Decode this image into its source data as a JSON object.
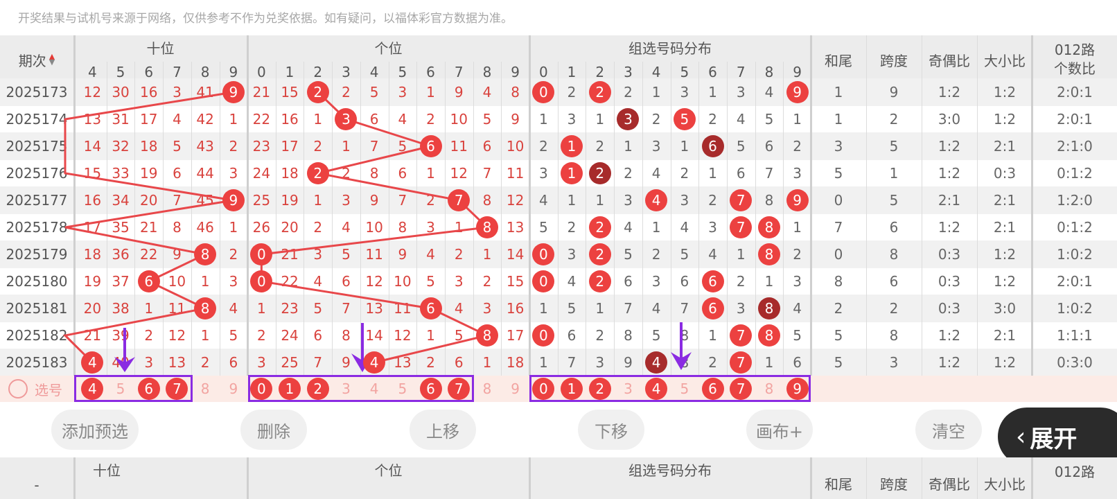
{
  "notice": "开奖结果与试机号来源于网络，仅供参考不作为兑奖依据。如有疑问，以福体彩官方数据为准。",
  "table_header": {
    "period_label": "期次",
    "tens_label": "十位",
    "units_label": "个位",
    "group_label": "组选号码分布",
    "sum_tail_label": "和尾",
    "span_label": "跨度",
    "odd_even_label": "奇偶比",
    "big_small_label": "大小比",
    "route_label_1": "012路",
    "route_label_2": "个数比",
    "tens_digits": [
      "4",
      "5",
      "6",
      "7",
      "8",
      "9"
    ],
    "units_digits": [
      "0",
      "1",
      "2",
      "3",
      "4",
      "5",
      "6",
      "7",
      "8",
      "9"
    ],
    "group_digits": [
      "0",
      "1",
      "2",
      "3",
      "4",
      "5",
      "6",
      "7",
      "8",
      "9"
    ]
  },
  "rows": [
    {
      "period": "2025173",
      "tens": [
        "12",
        "30",
        "16",
        "3",
        "41",
        "9"
      ],
      "tens_hit": 5,
      "units": [
        "21",
        "15",
        "2",
        "2",
        "5",
        "3",
        "1",
        "9",
        "4",
        "8"
      ],
      "units_hit": 2,
      "group": [
        "0",
        "2",
        "2",
        "2",
        "1",
        "3",
        "1",
        "3",
        "4",
        "9"
      ],
      "group_hit": [
        0,
        2,
        9
      ],
      "group_dark": [],
      "sum_tail": "1",
      "span": "9",
      "odd_even": "1:2",
      "big_small": "1:2",
      "route": "2:0:1"
    },
    {
      "period": "2025174",
      "tens": [
        "13",
        "31",
        "17",
        "4",
        "42",
        "1"
      ],
      "tens_hit": -1,
      "units": [
        "22",
        "16",
        "1",
        "3",
        "6",
        "4",
        "2",
        "10",
        "5",
        "9"
      ],
      "units_hit": 3,
      "group": [
        "1",
        "3",
        "1",
        "3",
        "2",
        "5",
        "2",
        "4",
        "5",
        "1"
      ],
      "group_hit": [
        3,
        5
      ],
      "group_dark": [
        3
      ],
      "sum_tail": "1",
      "span": "2",
      "odd_even": "3:0",
      "big_small": "1:2",
      "route": "2:0:1"
    },
    {
      "period": "2025175",
      "tens": [
        "14",
        "32",
        "18",
        "5",
        "43",
        "2"
      ],
      "tens_hit": -1,
      "units": [
        "23",
        "17",
        "2",
        "1",
        "7",
        "5",
        "6",
        "11",
        "6",
        "10"
      ],
      "units_hit": 6,
      "group": [
        "2",
        "1",
        "2",
        "1",
        "3",
        "1",
        "6",
        "5",
        "6",
        "2"
      ],
      "group_hit": [
        1,
        6
      ],
      "group_dark": [
        6
      ],
      "sum_tail": "3",
      "span": "5",
      "odd_even": "1:2",
      "big_small": "2:1",
      "route": "2:1:0"
    },
    {
      "period": "2025176",
      "tens": [
        "15",
        "33",
        "19",
        "6",
        "44",
        "3"
      ],
      "tens_hit": -1,
      "units": [
        "24",
        "18",
        "2",
        "2",
        "8",
        "6",
        "1",
        "12",
        "7",
        "11"
      ],
      "units_hit": 2,
      "group": [
        "3",
        "1",
        "2",
        "2",
        "4",
        "2",
        "1",
        "6",
        "7",
        "3"
      ],
      "group_hit": [
        1,
        2
      ],
      "group_dark": [
        2
      ],
      "sum_tail": "5",
      "span": "1",
      "odd_even": "1:2",
      "big_small": "0:3",
      "route": "0:1:2"
    },
    {
      "period": "2025177",
      "tens": [
        "16",
        "34",
        "20",
        "7",
        "45",
        "9"
      ],
      "tens_hit": 5,
      "units": [
        "25",
        "19",
        "1",
        "3",
        "9",
        "7",
        "2",
        "7",
        "8",
        "12"
      ],
      "units_hit": 7,
      "group": [
        "4",
        "1",
        "1",
        "3",
        "4",
        "3",
        "2",
        "7",
        "8",
        "9"
      ],
      "group_hit": [
        4,
        7,
        9
      ],
      "group_dark": [],
      "sum_tail": "0",
      "span": "5",
      "odd_even": "2:1",
      "big_small": "2:1",
      "route": "1:2:0"
    },
    {
      "period": "2025178",
      "tens": [
        "17",
        "35",
        "21",
        "8",
        "46",
        "1"
      ],
      "tens_hit": -1,
      "units": [
        "26",
        "20",
        "2",
        "4",
        "10",
        "8",
        "3",
        "1",
        "8",
        "13"
      ],
      "units_hit": 8,
      "group": [
        "5",
        "2",
        "2",
        "4",
        "1",
        "4",
        "3",
        "7",
        "8",
        "1"
      ],
      "group_hit": [
        2,
        7,
        8
      ],
      "group_dark": [],
      "sum_tail": "7",
      "span": "6",
      "odd_even": "1:2",
      "big_small": "2:1",
      "route": "0:1:2"
    },
    {
      "period": "2025179",
      "tens": [
        "18",
        "36",
        "22",
        "9",
        "8",
        "2"
      ],
      "tens_hit": 4,
      "units": [
        "0",
        "21",
        "3",
        "5",
        "11",
        "9",
        "4",
        "2",
        "1",
        "14"
      ],
      "units_hit": 0,
      "group": [
        "0",
        "3",
        "2",
        "5",
        "2",
        "5",
        "4",
        "1",
        "8",
        "2"
      ],
      "group_hit": [
        0,
        2,
        8
      ],
      "group_dark": [],
      "sum_tail": "0",
      "span": "8",
      "odd_even": "0:3",
      "big_small": "1:2",
      "route": "1:0:2"
    },
    {
      "period": "2025180",
      "tens": [
        "19",
        "37",
        "6",
        "10",
        "1",
        "3"
      ],
      "tens_hit": 2,
      "units": [
        "0",
        "22",
        "4",
        "6",
        "12",
        "10",
        "5",
        "3",
        "2",
        "15"
      ],
      "units_hit": 0,
      "group": [
        "0",
        "4",
        "2",
        "6",
        "3",
        "6",
        "6",
        "2",
        "1",
        "3"
      ],
      "group_hit": [
        0,
        2,
        6
      ],
      "group_dark": [],
      "sum_tail": "8",
      "span": "6",
      "odd_even": "0:3",
      "big_small": "1:2",
      "route": "2:0:1"
    },
    {
      "period": "2025181",
      "tens": [
        "20",
        "38",
        "1",
        "11",
        "8",
        "4"
      ],
      "tens_hit": 4,
      "units": [
        "1",
        "23",
        "5",
        "7",
        "13",
        "11",
        "6",
        "4",
        "3",
        "16"
      ],
      "units_hit": 6,
      "group": [
        "1",
        "5",
        "1",
        "7",
        "4",
        "7",
        "6",
        "3",
        "8",
        "4"
      ],
      "group_hit": [
        6,
        8
      ],
      "group_dark": [
        8
      ],
      "sum_tail": "2",
      "span": "2",
      "odd_even": "0:3",
      "big_small": "3:0",
      "route": "1:0:2"
    },
    {
      "period": "2025182",
      "tens": [
        "21",
        "39",
        "2",
        "12",
        "1",
        "5"
      ],
      "tens_hit": -1,
      "units": [
        "2",
        "24",
        "6",
        "8",
        "14",
        "12",
        "1",
        "5",
        "8",
        "17"
      ],
      "units_hit": 8,
      "group": [
        "0",
        "6",
        "2",
        "8",
        "5",
        "8",
        "1",
        "7",
        "8",
        "5"
      ],
      "group_hit": [
        0,
        7,
        8
      ],
      "group_dark": [],
      "sum_tail": "5",
      "span": "8",
      "odd_even": "1:2",
      "big_small": "2:1",
      "route": "1:1:1"
    },
    {
      "period": "2025183",
      "tens": [
        "4",
        "40",
        "3",
        "13",
        "2",
        "6"
      ],
      "tens_hit": 0,
      "units": [
        "3",
        "25",
        "7",
        "9",
        "4",
        "13",
        "2",
        "6",
        "1",
        "18"
      ],
      "units_hit": 4,
      "group": [
        "1",
        "7",
        "3",
        "9",
        "4",
        "8",
        "2",
        "7",
        "1",
        "6"
      ],
      "group_hit": [
        4,
        7
      ],
      "group_dark": [
        4
      ],
      "sum_tail": "5",
      "span": "3",
      "odd_even": "1:2",
      "big_small": "1:2",
      "route": "0:3:0"
    }
  ],
  "pick_row": {
    "label": "选号",
    "tens": [
      {
        "v": "4",
        "on": true
      },
      {
        "v": "5",
        "on": false
      },
      {
        "v": "6",
        "on": true
      },
      {
        "v": "7",
        "on": true
      },
      {
        "v": "8",
        "on": false
      },
      {
        "v": "9",
        "on": false
      }
    ],
    "units": [
      {
        "v": "0",
        "on": true
      },
      {
        "v": "1",
        "on": true
      },
      {
        "v": "2",
        "on": true
      },
      {
        "v": "3",
        "on": false
      },
      {
        "v": "4",
        "on": false
      },
      {
        "v": "5",
        "on": false
      },
      {
        "v": "6",
        "on": true
      },
      {
        "v": "7",
        "on": true
      },
      {
        "v": "8",
        "on": false
      },
      {
        "v": "9",
        "on": false
      }
    ],
    "group": [
      {
        "v": "0",
        "on": true
      },
      {
        "v": "1",
        "on": true
      },
      {
        "v": "2",
        "on": true
      },
      {
        "v": "3",
        "on": false
      },
      {
        "v": "4",
        "on": true
      },
      {
        "v": "5",
        "on": false
      },
      {
        "v": "6",
        "on": true
      },
      {
        "v": "7",
        "on": true
      },
      {
        "v": "8",
        "on": false
      },
      {
        "v": "9",
        "on": true
      }
    ]
  },
  "buttons": {
    "add_preselect": "添加预选",
    "delete": "删除",
    "move_up": "上移",
    "move_down": "下移",
    "canvas_plus": "画布+",
    "clear": "清空",
    "expand": "展开"
  },
  "bottom_header": {
    "period_label": "-",
    "tens_label": "十位",
    "units_label": "个位",
    "group_label": "组选号码分布",
    "sum_tail_label": "和尾",
    "span_label": "跨度",
    "odd_even_label": "奇偶比",
    "big_small_label": "大小比",
    "route_label": "012路"
  },
  "colors": {
    "ball": "#ec4140",
    "ball_dark": "#a72b2b",
    "number_text": "#d9423d",
    "selection_box": "#8a2be2",
    "arrow": "#8a2be2"
  }
}
